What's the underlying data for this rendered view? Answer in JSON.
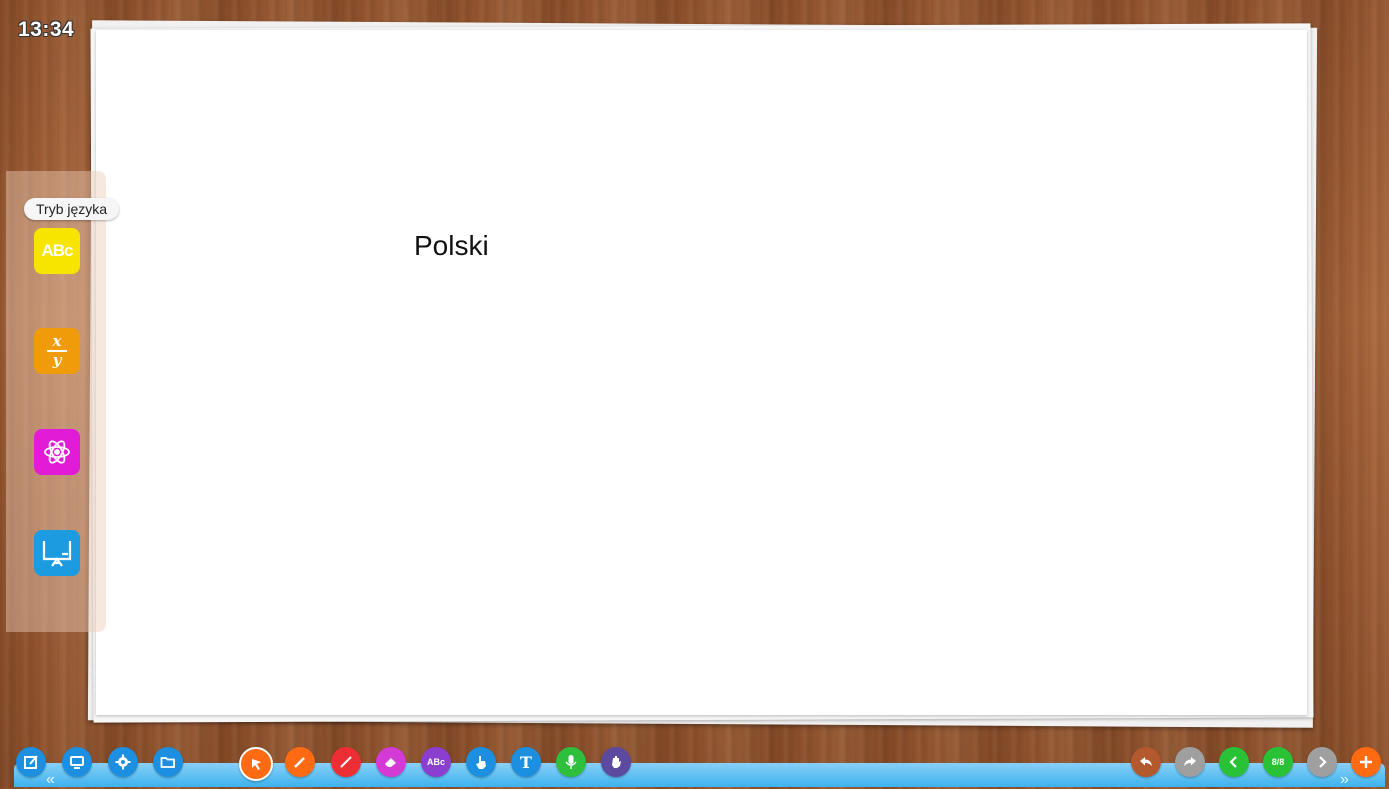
{
  "clock": {
    "time": "13:34"
  },
  "canvas": {
    "text": "Polski"
  },
  "side_panel": {
    "tooltip": "Tryb języka",
    "lang_button_label": "ABc",
    "math_button_top": "x",
    "math_button_bottom": "y"
  },
  "bottom_toolbar": {
    "text_tool_label": "ABc",
    "type_tool_label": "T",
    "page_indicator": "8/8"
  },
  "colors": {
    "lang": "#f7e500",
    "math": "#ef9b0a",
    "science": "#e21bd7",
    "board": "#1d9be1",
    "bar": "#3db2ee"
  }
}
